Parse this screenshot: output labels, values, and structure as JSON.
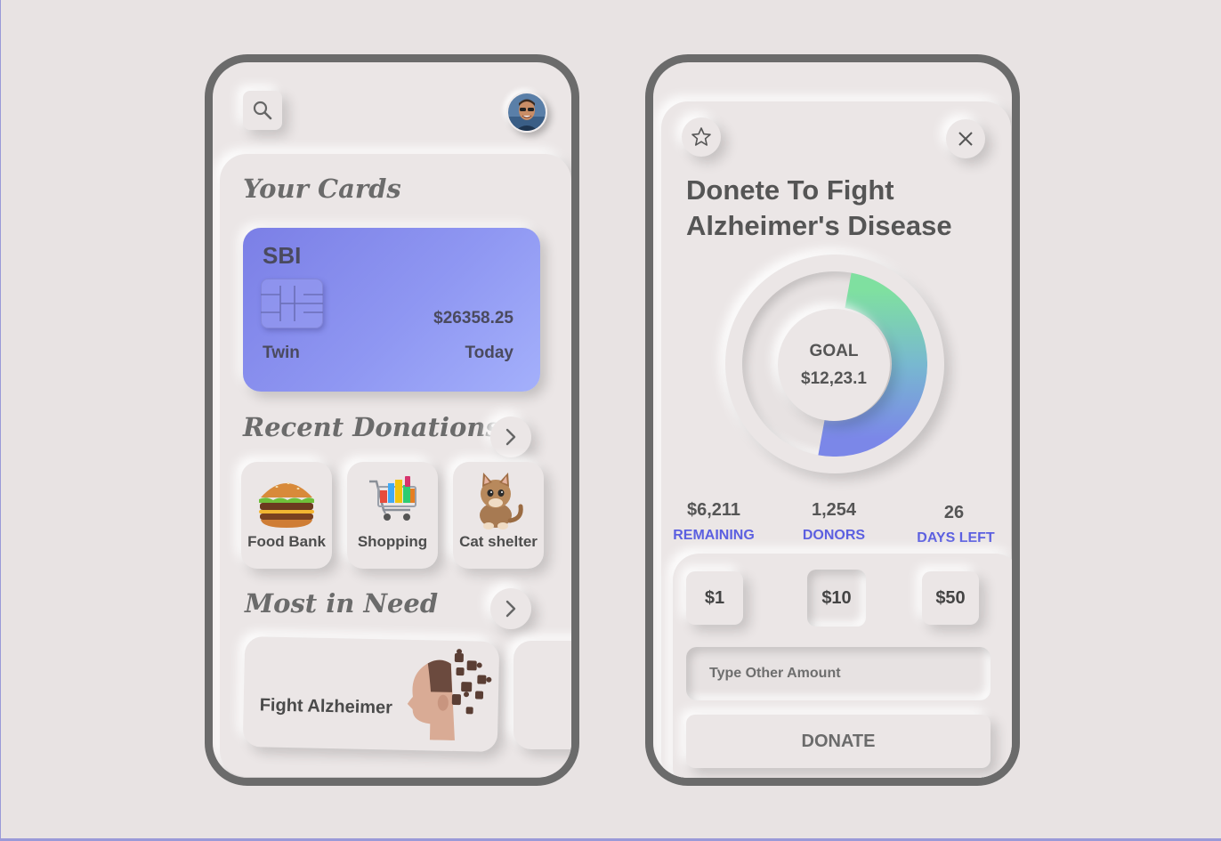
{
  "colors": {
    "background": "#e8e3e3",
    "phone_frame": "#6b6b6b",
    "accent": "#5b5fe0",
    "card_gradient_start": "#7b7fe6",
    "card_gradient_end": "#a4b0fb",
    "progress_start": "#7fe0a0",
    "progress_end": "#7b87e8"
  },
  "left_phone": {
    "search_icon": "search-icon",
    "cards_title": "Your Cards",
    "bank_card": {
      "bank": "SBI",
      "balance": "$26358.25",
      "holder": "Twin",
      "date": "Today"
    },
    "recent_title": "Recent Donations",
    "recent_items": [
      {
        "label": "Food Bank",
        "icon": "burger-icon"
      },
      {
        "label": "Shopping",
        "icon": "shopping-cart-icon"
      },
      {
        "label": "Cat shelter",
        "icon": "kitten-icon"
      }
    ],
    "need_title": "Most in Need",
    "need_items": [
      {
        "label": "Fight Alzheimer",
        "icon": "head-puzzle-icon"
      }
    ]
  },
  "right_phone": {
    "title_line1": "Donete To Fight",
    "title_line2": "Alzheimer's Disease",
    "goal_label": "GOAL",
    "goal_value": "$12,23.1",
    "progress_fraction": 0.5,
    "stats": [
      {
        "value": "$6,211",
        "label": "REMAINING"
      },
      {
        "value": "1,254",
        "label": "DONORS"
      },
      {
        "value": "26",
        "label": "DAYS LEFT"
      }
    ],
    "amounts": [
      "$1",
      "$10",
      "$50"
    ],
    "selected_amount": "$10",
    "amount_placeholder": "Type Other Amount",
    "donate_label": "DONATE"
  }
}
